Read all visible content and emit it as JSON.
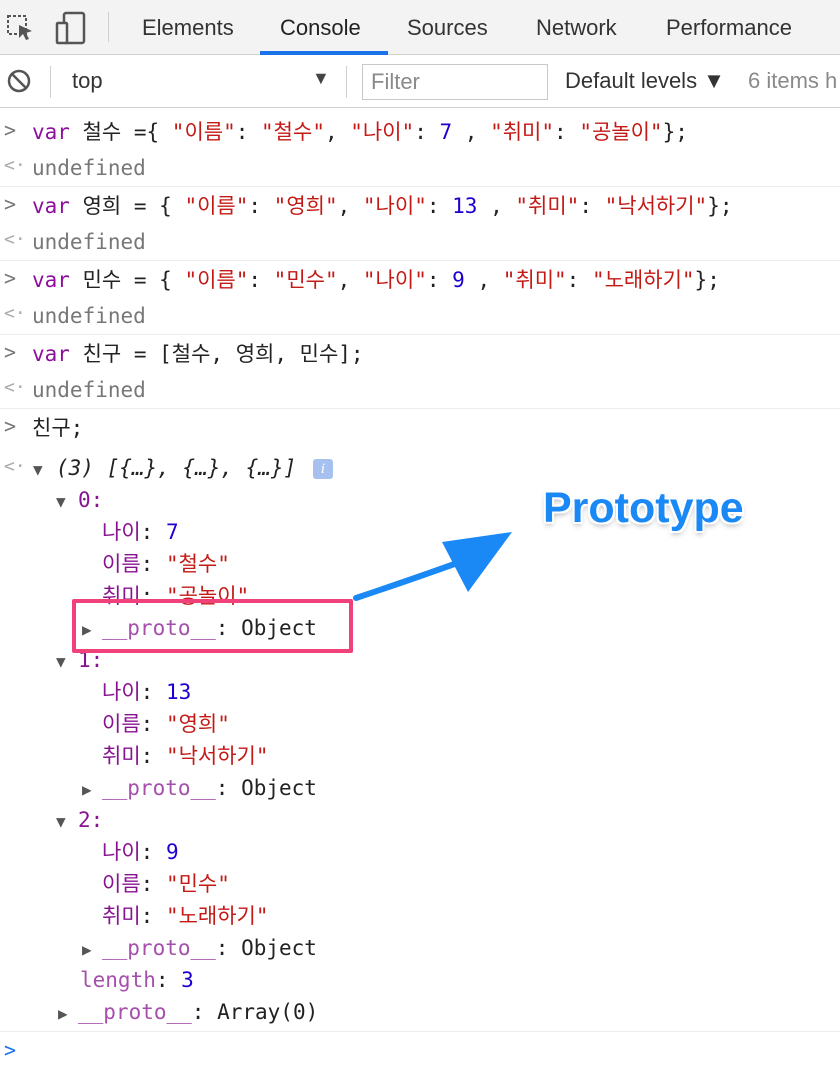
{
  "tabs": [
    "Elements",
    "Console",
    "Sources",
    "Network",
    "Performance"
  ],
  "toolbar": {
    "context": "top",
    "filter_placeholder": "Filter",
    "levels": "Default levels ▼",
    "items": "6 items h"
  },
  "entries": {
    "l1": {
      "kw": "var",
      "a": " 철수 ={ ",
      "k1": "\"이름\"",
      "c1": ": ",
      "v1": "\"철수\"",
      "c2": ", ",
      "k2": "\"나이\"",
      "c3": ": ",
      "n": "7",
      "c4": " , ",
      "k3": "\"취미\"",
      "c5": ": ",
      "v3": "\"공놀이\"",
      "end": "};"
    },
    "l2": {
      "kw": "var",
      "a": " 영희 = { ",
      "k1": "\"이름\"",
      "c1": ": ",
      "v1": "\"영희\"",
      "c2": ", ",
      "k2": "\"나이\"",
      "c3": ": ",
      "n": "13",
      "c4": " , ",
      "k3": "\"취미\"",
      "c5": ": ",
      "v3": "\"낙서하기\"",
      "end": "};"
    },
    "l3": {
      "kw": "var",
      "a": " 민수 = { ",
      "k1": "\"이름\"",
      "c1": ": ",
      "v1": "\"민수\"",
      "c2": ", ",
      "k2": "\"나이\"",
      "c3": ": ",
      "n": "9",
      "c4": " , ",
      "k3": "\"취미\"",
      "c5": ": ",
      "v3": "\"노래하기\"",
      "end": "};"
    },
    "l4": {
      "kw": "var",
      "a": " 친구 = [철수, 영희, 민수];"
    },
    "undefined": "undefined",
    "l5": "친구;",
    "result_head": "(3) [{…}, {…}, {…}]",
    "items": [
      {
        "idx": "0:",
        "age_k": "나이",
        "age": "7",
        "name_k": "이름",
        "name": "\"철수\"",
        "hobby_k": "취미",
        "hobby": "\"공놀이\""
      },
      {
        "idx": "1:",
        "age_k": "나이",
        "age": "13",
        "name_k": "이름",
        "name": "\"영희\"",
        "hobby_k": "취미",
        "hobby": "\"낙서하기\""
      },
      {
        "idx": "2:",
        "age_k": "나이",
        "age": "9",
        "name_k": "이름",
        "name": "\"민수\"",
        "hobby_k": "취미",
        "hobby": "\"노래하기\""
      }
    ],
    "proto": "__proto__",
    "proto_obj": "Object",
    "length_k": "length",
    "length_v": "3",
    "array_proto": "Array(0)"
  },
  "annotation": {
    "label": "Prototype"
  },
  "colors": {
    "accent": "#1a73e8",
    "highlight": "#f0417a",
    "arrow": "#1a88f5"
  }
}
